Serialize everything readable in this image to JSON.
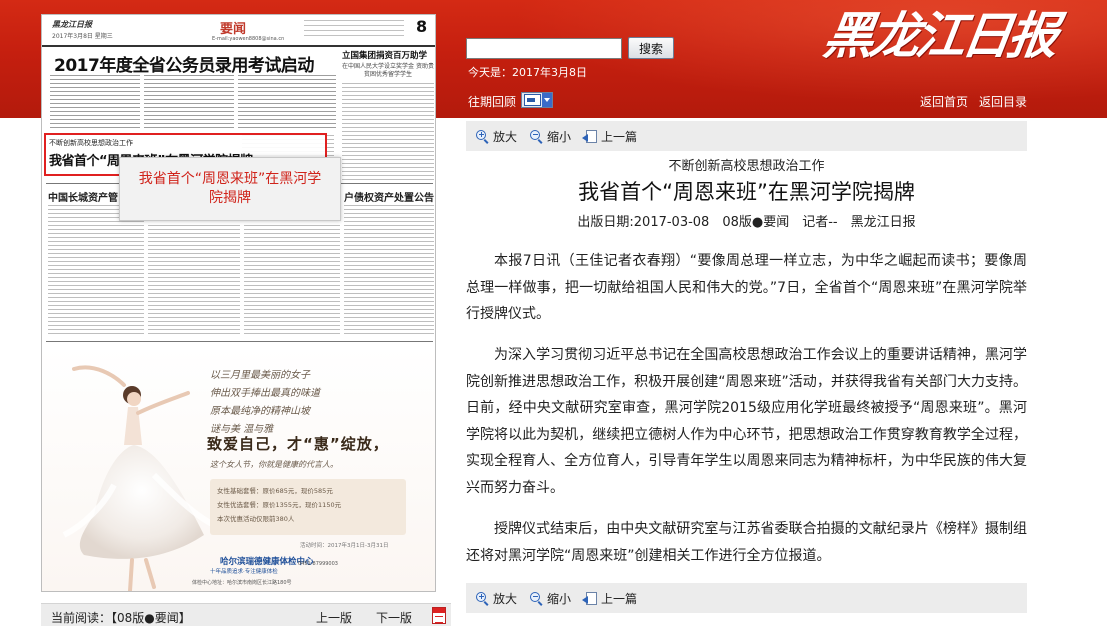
{
  "banner": {
    "logo": "黑龙江日报",
    "search_placeholder": "",
    "search_button": "搜索",
    "today": "今天是：2017年3月8日",
    "history_label": "往期回顾",
    "calendar_icon": "calendar-icon",
    "nav_home": "返回首页",
    "nav_directory": "返回目录"
  },
  "page_image": {
    "masthead": "黑龙江日报",
    "date_line": "2017年3月8日  星期三",
    "section": "要闻",
    "email": "E-mail:yaowen8808@sina.cn",
    "page_number": "8",
    "headline": "2017年度全省公务员录用考试启动",
    "side_title": "立国集团捐资百万助学",
    "side_subtitle": "在中国人民大学设立奖学金 资助贵贫困优秀留学学生",
    "highlight_kicker": "不断创新高校思想政治工作",
    "highlight_title": "我省首个“周恩来班”在黑河学院揭牌",
    "tooltip": "我省首个“周恩来班”在黑河学院揭牌",
    "ad_left_title": "中国长城资产管",
    "ad_right_title": "户债权资产处置公告",
    "ad_poem": [
      "以三月里最美丽的女子",
      "伸出双手捧出最真的味道",
      "原本最纯净的精神山坡",
      "谜与美 温与雅"
    ],
    "ad_slogan": "致爱自己，才“惠”绽放，",
    "ad_slogan2": "这个女人节，你就是健康的代言人。",
    "ad_offers": [
      "女性基础套餐：原价685元，现价585元",
      "女性优选套餐：原价1355元，现价1150元",
      "本次优惠活动仅限前380人"
    ],
    "ad_date": "活动时间：2017年3月1日-3月31日",
    "ad_brand": "哈尔滨瑞德健康体检中心",
    "ad_brand_sub": "十年品质追求·专注健康体检",
    "ad_phone": "0451-87999003",
    "ad_address": "体检中心地址：哈尔滨市南岗区长江路180号"
  },
  "reading_bar": {
    "label": "当前阅读：【08版●要闻】",
    "prev": "上一版",
    "next": "下一版",
    "pdf_icon": "pdf-icon"
  },
  "toolbar": {
    "zoom_in": "放大",
    "zoom_out": "缩小",
    "prev_article": "上一篇",
    "zoom_in_icon": "zoom-in-icon",
    "zoom_out_icon": "zoom-out-icon",
    "prev_icon": "previous-article-icon"
  },
  "article": {
    "kicker": "不断创新高校思想政治工作",
    "headline": "我省首个“周恩来班”在黑河学院揭牌",
    "meta": "出版日期:2017-03-08　08版●要闻　记者--　黑龙江日报",
    "paragraphs": [
      "本报7日讯（王佳记者衣春翔）“要像周总理一样立志，为中华之崛起而读书；要像周总理一样做事，把一切献给祖国人民和伟大的党。”7日，全省首个“周恩来班”在黑河学院举行授牌仪式。",
      "为深入学习贯彻习近平总书记在全国高校思想政治工作会议上的重要讲话精神，黑河学院创新推进思想政治工作，积极开展创建“周恩来班”活动，并获得我省有关部门大力支持。日前，经中央文献研究室审查，黑河学院2015级应用化学班最终被授予“周恩来班”。黑河学院将以此为契机，继续把立德树人作为中心环节，把思想政治工作贯穿教育教学全过程，实现全程育人、全方位育人，引导青年学生以周恩来同志为精神标杆，为中华民族的伟大复兴而努力奋斗。",
      "授牌仪式结束后，由中央文献研究室与江苏省委联合拍摄的文献纪录片《榜样》摄制组还将对黑河学院“周恩来班”创建相关工作进行全方位报道。"
    ]
  },
  "colors": {
    "banner_red": "#c51f0f",
    "highlight_red": "#e02020",
    "tooltip_text": "#d0231a",
    "toolbar_bg": "#ececec"
  }
}
